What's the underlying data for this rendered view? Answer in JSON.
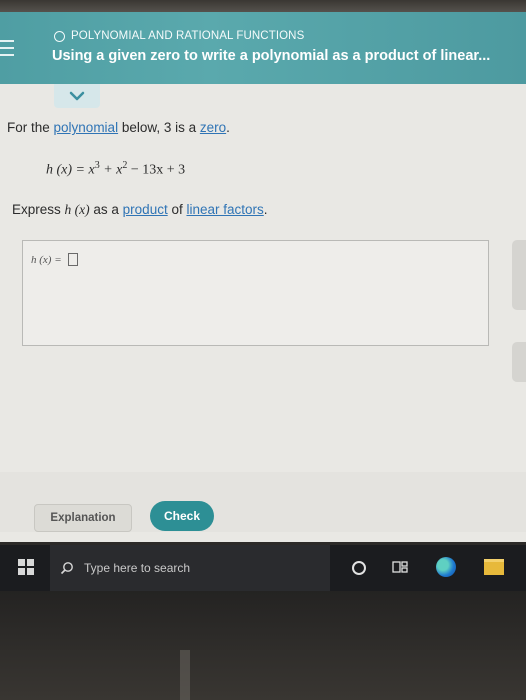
{
  "header": {
    "topic": "POLYNOMIAL AND RATIONAL FUNCTIONS",
    "title": "Using a given zero to write a polynomial as a product of linear..."
  },
  "problem": {
    "intro_prefix": "For the ",
    "intro_link_polynomial": "polynomial",
    "intro_middle": " below, 3 is a ",
    "intro_link_zero": "zero",
    "intro_suffix": ".",
    "equation_lhs": "h (x) = x",
    "equation_exp1": "3",
    "equation_mid": " + x",
    "equation_exp2": "2",
    "equation_rest": " − 13x + 3",
    "instruction_prefix": "Express ",
    "instruction_func": "h (x)",
    "instruction_middle": " as a ",
    "instruction_link_product": "product",
    "instruction_of": " of ",
    "instruction_link_linear": "linear factors",
    "instruction_suffix": "."
  },
  "answer": {
    "label": "h (x) ="
  },
  "buttons": {
    "explanation": "Explanation",
    "check": "Check"
  },
  "taskbar": {
    "search_placeholder": "Type here to search"
  },
  "colors": {
    "header_teal": "#4f9ea3",
    "check_button": "#2d8f95",
    "link_blue": "#2f74b5",
    "taskbar": "#1b1c1f"
  },
  "icons": [
    "menu-icon",
    "circle-icon",
    "chevron-down-icon",
    "windows-start-icon",
    "search-icon",
    "cortana-icon",
    "task-view-icon",
    "edge-icon",
    "file-explorer-icon"
  ]
}
